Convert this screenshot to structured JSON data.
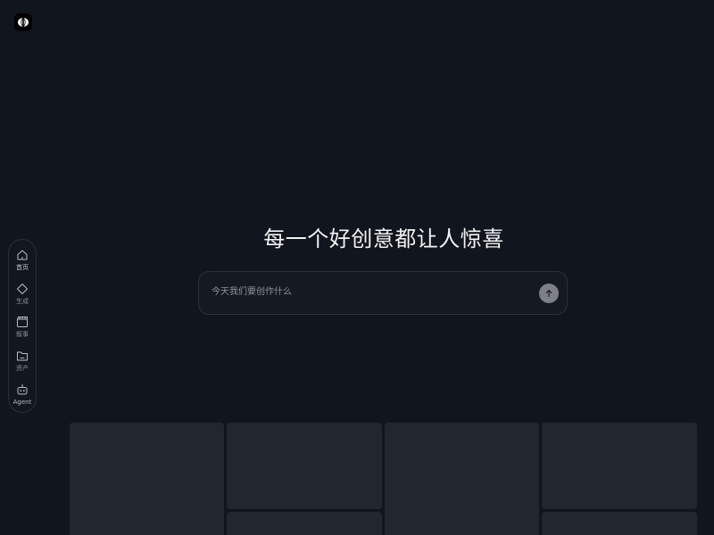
{
  "app": {
    "logo_icon": "eye-logo-icon"
  },
  "sidebar": {
    "items": [
      {
        "label": "首页",
        "icon": "home-icon"
      },
      {
        "label": "生成",
        "icon": "diamond-icon"
      },
      {
        "label": "叙事",
        "icon": "clapperboard-icon"
      },
      {
        "label": "资产",
        "icon": "folder-icon"
      },
      {
        "label": "Agent",
        "icon": "robot-icon"
      }
    ]
  },
  "hero": {
    "headline": "每一个好创意都让人惊喜"
  },
  "prompt": {
    "placeholder": "今天我们要创作什么",
    "value": "",
    "send_icon": "arrow-up-icon"
  },
  "gallery": {
    "cards": [
      {
        "name": "card-1"
      },
      {
        "name": "card-2"
      },
      {
        "name": "card-3"
      },
      {
        "name": "card-4"
      },
      {
        "name": "card-5"
      },
      {
        "name": "card-6"
      },
      {
        "name": "card-7"
      }
    ]
  },
  "colors": {
    "background": "#11151d",
    "card": "#22262f",
    "send_button": "#7d8087",
    "border": "#2c313a"
  }
}
